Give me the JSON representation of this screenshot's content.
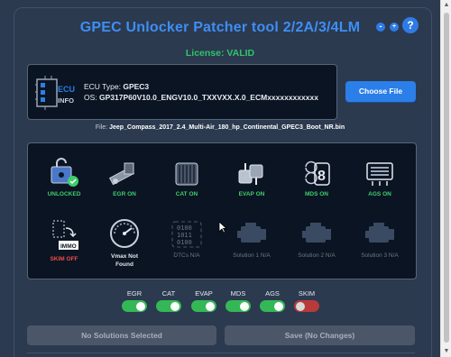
{
  "app": {
    "title": "GPEC Unlocker Patcher tool 2/2A/3/4LM",
    "license": "License: VALID",
    "window_buttons": [
      "-",
      "+",
      "?"
    ]
  },
  "ecu": {
    "icon_text_top": "ECU",
    "icon_text_bottom": "INFO",
    "type_label": "ECU Type:",
    "type_value": "GPEC3",
    "os_label": "OS:",
    "os_value": "GP317P60V10.0_ENGV10.0_TXXVXX.X.0_ECMxxxxxxxxxxxx",
    "choose_button": "Choose File"
  },
  "file": {
    "label": "File:",
    "name": "Jeep_Compass_2017_2.4_Multi-Air_180_hp_Continental_GPEC3_Boot_NR.bin"
  },
  "solutions": [
    {
      "label": "UNLOCKED",
      "status": "on",
      "icon": "unlock-chip-icon"
    },
    {
      "label": "EGR ON",
      "status": "on",
      "icon": "egr-valve-icon"
    },
    {
      "label": "CAT ON",
      "status": "on",
      "icon": "catalytic-converter-icon"
    },
    {
      "label": "EVAP ON",
      "status": "on",
      "icon": "evap-canister-icon"
    },
    {
      "label": "MDS ON",
      "status": "on",
      "icon": "engine-cylinder-icon"
    },
    {
      "label": "AGS ON",
      "status": "on",
      "icon": "grille-shutter-icon"
    },
    {
      "label": "SKIM OFF",
      "status": "off",
      "icon": "immobilizer-icon",
      "badge": "IMMO"
    },
    {
      "label": "Vmax Not Found",
      "status": "info",
      "icon": "speedometer-icon"
    },
    {
      "label": "DTCs N/A",
      "status": "na",
      "icon": "binary-code-icon",
      "binary": [
        "0100",
        "1011",
        "0100"
      ]
    },
    {
      "label": "Solution 1 N/A",
      "status": "na",
      "icon": "engine-icon"
    },
    {
      "label": "Solution 2 N/A",
      "status": "na",
      "icon": "engine-icon"
    },
    {
      "label": "Solution 3 N/A",
      "status": "na",
      "icon": "engine-icon"
    }
  ],
  "toggles": [
    {
      "label": "EGR",
      "state": "on"
    },
    {
      "label": "CAT",
      "state": "on"
    },
    {
      "label": "EVAP",
      "state": "on"
    },
    {
      "label": "MDS",
      "state": "on"
    },
    {
      "label": "AGS",
      "state": "on"
    },
    {
      "label": "SKIM",
      "state": "off"
    }
  ],
  "actions": {
    "solutions_button": "No Solutions Selected",
    "save_button": "Save (No Changes)"
  },
  "colors": {
    "background": "#2b3a4f",
    "panel": "#0b1422",
    "accent": "#2b7fe8",
    "title": "#3e8ef4",
    "enabled_green": "#3ecf6d",
    "disabled_red": "#ee4b4b",
    "na_gray": "#6d7685"
  }
}
